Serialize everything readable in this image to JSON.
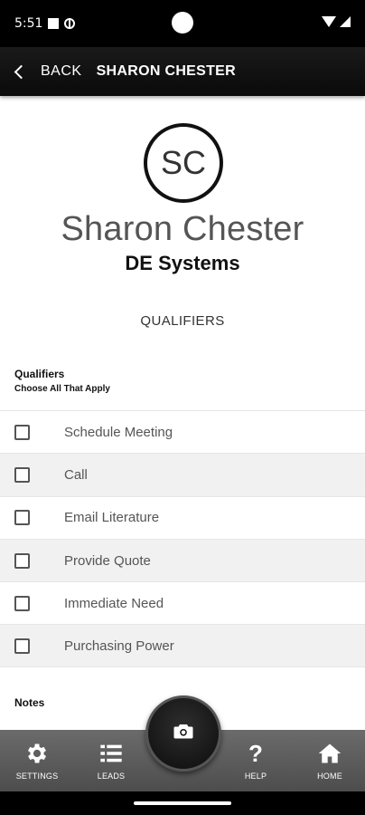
{
  "status_bar": {
    "time": "5:51"
  },
  "header": {
    "back_label": "BACK",
    "title": "SHARON CHESTER"
  },
  "profile": {
    "initials": "SC",
    "name": "Sharon Chester",
    "company": "DE Systems"
  },
  "section_title": "QUALIFIERS",
  "qualifiers": {
    "heading": "Qualifiers",
    "subheading": "Choose All That Apply",
    "items": [
      {
        "label": "Schedule Meeting",
        "checked": false
      },
      {
        "label": "Call",
        "checked": false
      },
      {
        "label": "Email Literature",
        "checked": false
      },
      {
        "label": "Provide Quote",
        "checked": false
      },
      {
        "label": "Immediate Need",
        "checked": false
      },
      {
        "label": "Purchasing Power",
        "checked": false
      }
    ]
  },
  "notes_label": "Notes",
  "bottom_nav": {
    "settings": "SETTINGS",
    "leads": "LEADS",
    "help": "HELP",
    "home": "HOME"
  },
  "colors": {
    "header_bg": "#111111",
    "nav_bg": "#5c5c5c",
    "alt_row": "#f1f1f1"
  }
}
